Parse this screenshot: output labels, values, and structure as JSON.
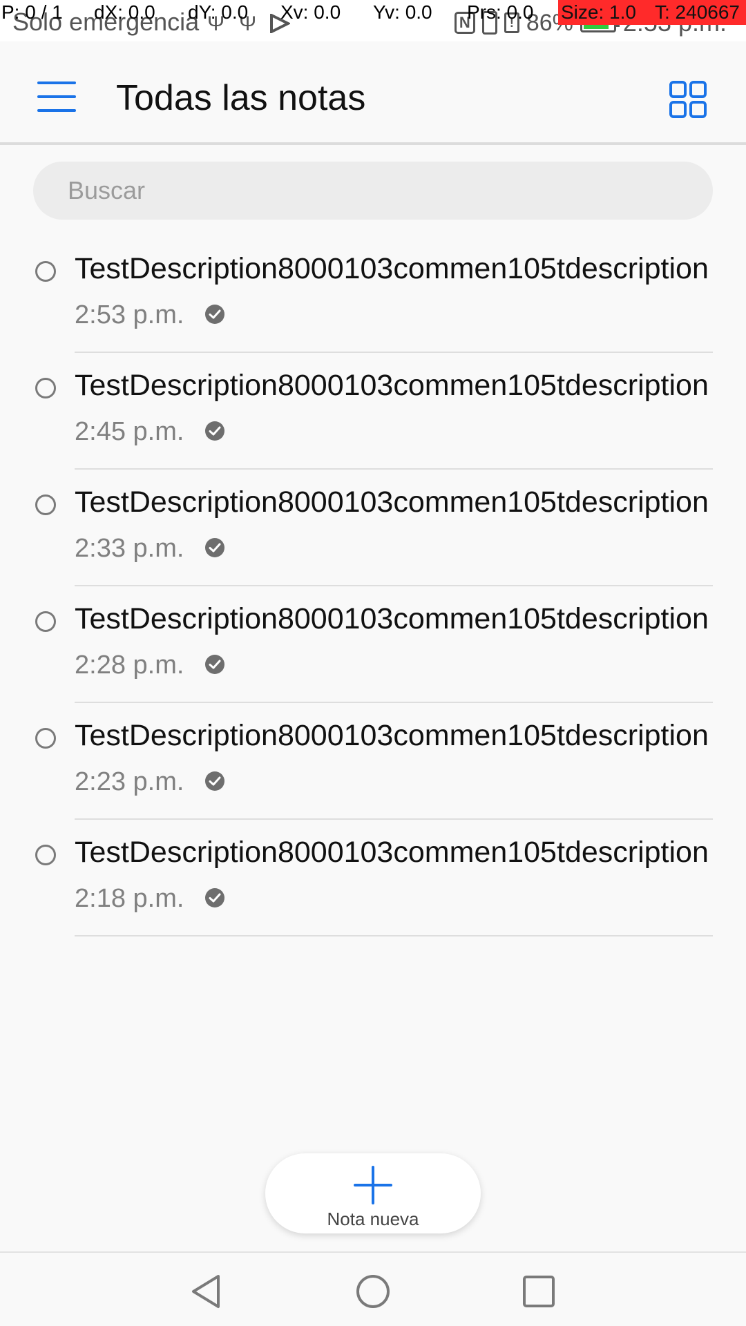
{
  "status_bar": {
    "carrier": "Solo emergencia",
    "battery_percent": "86%",
    "time": "2:53 p.m.",
    "battery_level": 0.86
  },
  "pointer_overlay": {
    "p": "P: 0 / 1",
    "dx": "dX: 0.0",
    "dy": "dY: 0.0",
    "xv": "Xv: 0.0",
    "yv": "Yv: 0.0",
    "prs": "Prs: 0.0",
    "size": "Size: 1.0",
    "t": "T: 240667"
  },
  "app_bar": {
    "title": "Todas las notas",
    "accent_color": "#1a73e8"
  },
  "search": {
    "placeholder": "Buscar",
    "value": ""
  },
  "notes": [
    {
      "title": "TestDescription8000103commen105tdescription",
      "time": "2:53 p.m."
    },
    {
      "title": "TestDescription8000103commen105tdescription",
      "time": "2:45 p.m."
    },
    {
      "title": "TestDescription8000103commen105tdescription",
      "time": "2:33 p.m."
    },
    {
      "title": "TestDescription8000103commen105tdescription",
      "time": "2:28 p.m."
    },
    {
      "title": "TestDescription8000103commen105tdescription",
      "time": "2:23 p.m."
    },
    {
      "title": "TestDescription8000103commen105tdescription",
      "time": "2:18 p.m."
    }
  ],
  "fab": {
    "label": "Nota nueva"
  },
  "icons": {
    "menu": "hamburger-menu-icon",
    "grid": "grid-view-icon",
    "sync": "check-circle-icon",
    "add": "plus-icon",
    "back": "back-triangle-icon",
    "home": "home-circle-icon",
    "recents": "recents-square-icon"
  }
}
